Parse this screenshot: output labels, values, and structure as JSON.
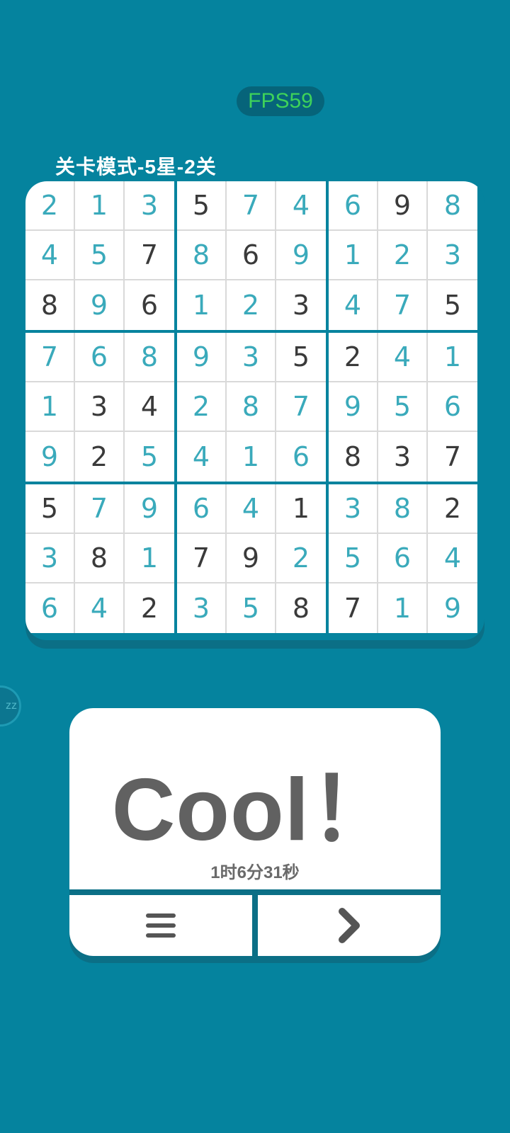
{
  "fps_label": "FPS59",
  "level_title": "关卡模式-5星-2关",
  "board": {
    "rows": [
      "213574698",
      "457869123",
      "896123475",
      "768935241",
      "134287956",
      "925416837",
      "579641382",
      "381792564",
      "642358719"
    ],
    "given_cells": [
      "000100010",
      "001010000",
      "101001001",
      "000001100",
      "011000000",
      "010000111",
      "100001001",
      "010110000",
      "001001100"
    ],
    "colors": {
      "given": "#3a3a3a",
      "filled": "#3aaabb",
      "background": "#05839e"
    }
  },
  "side_button_label": "zz",
  "result": {
    "title": "Cool！",
    "time": "1时6分31秒"
  },
  "icons": {
    "menu": "menu-icon",
    "next": "chevron-right-icon"
  }
}
